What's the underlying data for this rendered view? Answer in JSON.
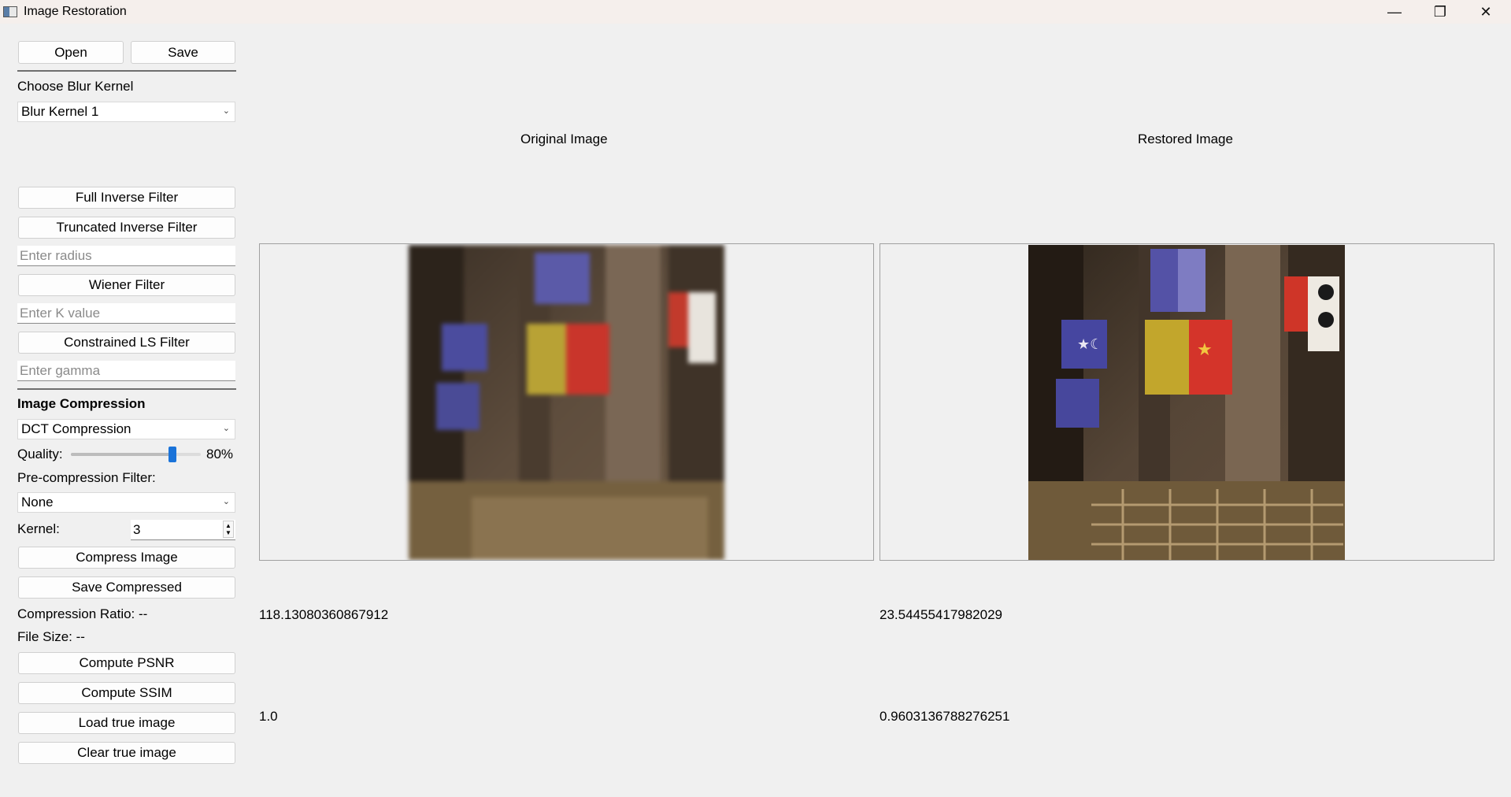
{
  "window": {
    "title": "Image Restoration"
  },
  "file": {
    "open_label": "Open",
    "save_label": "Save"
  },
  "blur": {
    "heading": "Choose Blur Kernel",
    "selected": "Blur Kernel 1"
  },
  "filters": {
    "full_inverse_label": "Full Inverse Filter",
    "truncated_inverse_label": "Truncated Inverse Filter",
    "radius_placeholder": "Enter radius",
    "wiener_label": "Wiener Filter",
    "k_placeholder": "Enter K value",
    "cls_label": "Constrained LS Filter",
    "gamma_placeholder": "Enter gamma"
  },
  "compression": {
    "heading": "Image Compression",
    "method": "DCT Compression",
    "quality_label": "Quality:",
    "quality_value": 80,
    "quality_text": "80%",
    "prefilter_label": "Pre-compression Filter:",
    "prefilter_selected": "None",
    "kernel_label": "Kernel:",
    "kernel_value": "3",
    "compress_label": "Compress Image",
    "save_compressed_label": "Save Compressed",
    "ratio_text": "Compression Ratio: --",
    "filesize_text": "File Size: --"
  },
  "metrics": {
    "psnr_label": "Compute PSNR",
    "ssim_label": "Compute SSIM",
    "load_true_label": "Load true image",
    "clear_true_label": "Clear true image"
  },
  "panels": {
    "original_title": "Original Image",
    "restored_title": "Restored Image",
    "original_psnr": "118.13080360867912",
    "restored_psnr": "23.54455417982029",
    "original_ssim": "1.0",
    "restored_ssim": "0.9603136788276251"
  },
  "colors": {
    "accent": "#1a73d9"
  }
}
